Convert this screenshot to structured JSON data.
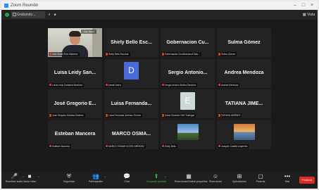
{
  "window": {
    "title": "Zoom Reunión"
  },
  "topbar": {
    "meeting_chip": "Grabando...",
    "view_label": "Vista"
  },
  "participants": [
    {
      "name": "",
      "label": "Juan David Ruiz Martínez",
      "type": "video",
      "active": true,
      "video_tag": "Juan David"
    },
    {
      "name": "Shirly Bello Esc...",
      "label": "Shirly Bello Escobar",
      "type": "text"
    },
    {
      "name": "Gobernacion Cu...",
      "label": "Gobernacion Cundinamarca Salu...",
      "type": "text"
    },
    {
      "name": "Sulma Gómez",
      "label": "Sulma Gómez",
      "type": "text"
    },
    {
      "name": "Luisa Leidy San...",
      "label": "Luisa Leidy Sanabria Martínez",
      "type": "text"
    },
    {
      "name": "",
      "label": "Daniel Avera",
      "type": "avatar",
      "initial": "D",
      "avatar_color": "#4a6ad9"
    },
    {
      "name": "Sergio Antonio...",
      "label": "Sergio Antonio Molina Sánchez",
      "type": "text"
    },
    {
      "name": "Andrea Mendoza",
      "label": "Andrea Mendoza",
      "type": "text"
    },
    {
      "name": "José Gregorio E...",
      "label": "José Gregorio Estrada Jiménez",
      "type": "text"
    },
    {
      "name": "Luisa Fernanda...",
      "label": "Luisa Fernanda Jiménez Gómez",
      "type": "text"
    },
    {
      "name": "",
      "label": "Salud Girardot CNO Toalhgaz",
      "type": "avatar",
      "initial": "E",
      "avatar_color": "#cfd8d8"
    },
    {
      "name": "TATIANA JIME...",
      "label": "TATIANA JIMÉNEZ",
      "type": "text"
    },
    {
      "name": "Esteban Mancera",
      "label": "Esteban Mancera",
      "type": "text"
    },
    {
      "name": "MARCO OSMA...",
      "label": "MARCO OSMAR ACERO MÉNDEZ",
      "type": "text"
    },
    {
      "name": "",
      "label": "Shirly Bello",
      "type": "image",
      "image": "landscape"
    },
    {
      "name": "",
      "label": "Joaquim Castillo Izquierdo",
      "type": "image",
      "image": "sunset"
    }
  ],
  "toolbar": [
    {
      "label": "Reactivar audio",
      "icon": "microphone-icon",
      "glyph": "🎤"
    },
    {
      "label": "Iniciar video",
      "icon": "video-camera-icon",
      "glyph": "■"
    },
    {
      "label": "Seguridad",
      "icon": "shield-icon",
      "glyph": "⛨"
    },
    {
      "label": "Participantes",
      "icon": "participants-icon",
      "glyph": "👥"
    },
    {
      "label": "Chat",
      "icon": "chat-icon",
      "glyph": "💬"
    },
    {
      "label": "Compartir pantalla",
      "icon": "share-screen-icon",
      "glyph": "⬆"
    },
    {
      "label": "Reacciones/Grabar pequeñas",
      "icon": "breakout-rooms-icon",
      "glyph": "▦"
    },
    {
      "label": "Reacciones",
      "icon": "reactions-icon",
      "glyph": "☺"
    },
    {
      "label": "Aplicaciones",
      "icon": "apps-icon",
      "glyph": "⊞"
    },
    {
      "label": "Pizarras",
      "icon": "whiteboard-icon",
      "glyph": "▢"
    },
    {
      "label": "Más",
      "icon": "more-icon",
      "glyph": "•••"
    }
  ],
  "leave_label": "Finalizar"
}
